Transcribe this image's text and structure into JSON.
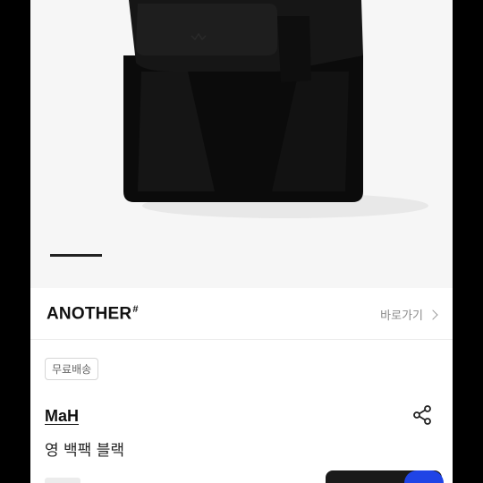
{
  "product": {
    "image_alt": "black backpack",
    "brand": {
      "name": "ANOTHER",
      "mark": "#",
      "link_label": "바로가기"
    },
    "badge": "무료배송",
    "seller": "MaH",
    "title": "영 백팩 블랙"
  },
  "colors": {
    "background": "#000000",
    "card": "#ffffff",
    "hero_bg": "#f6f6f6",
    "accent_blue": "#1f44e6"
  }
}
